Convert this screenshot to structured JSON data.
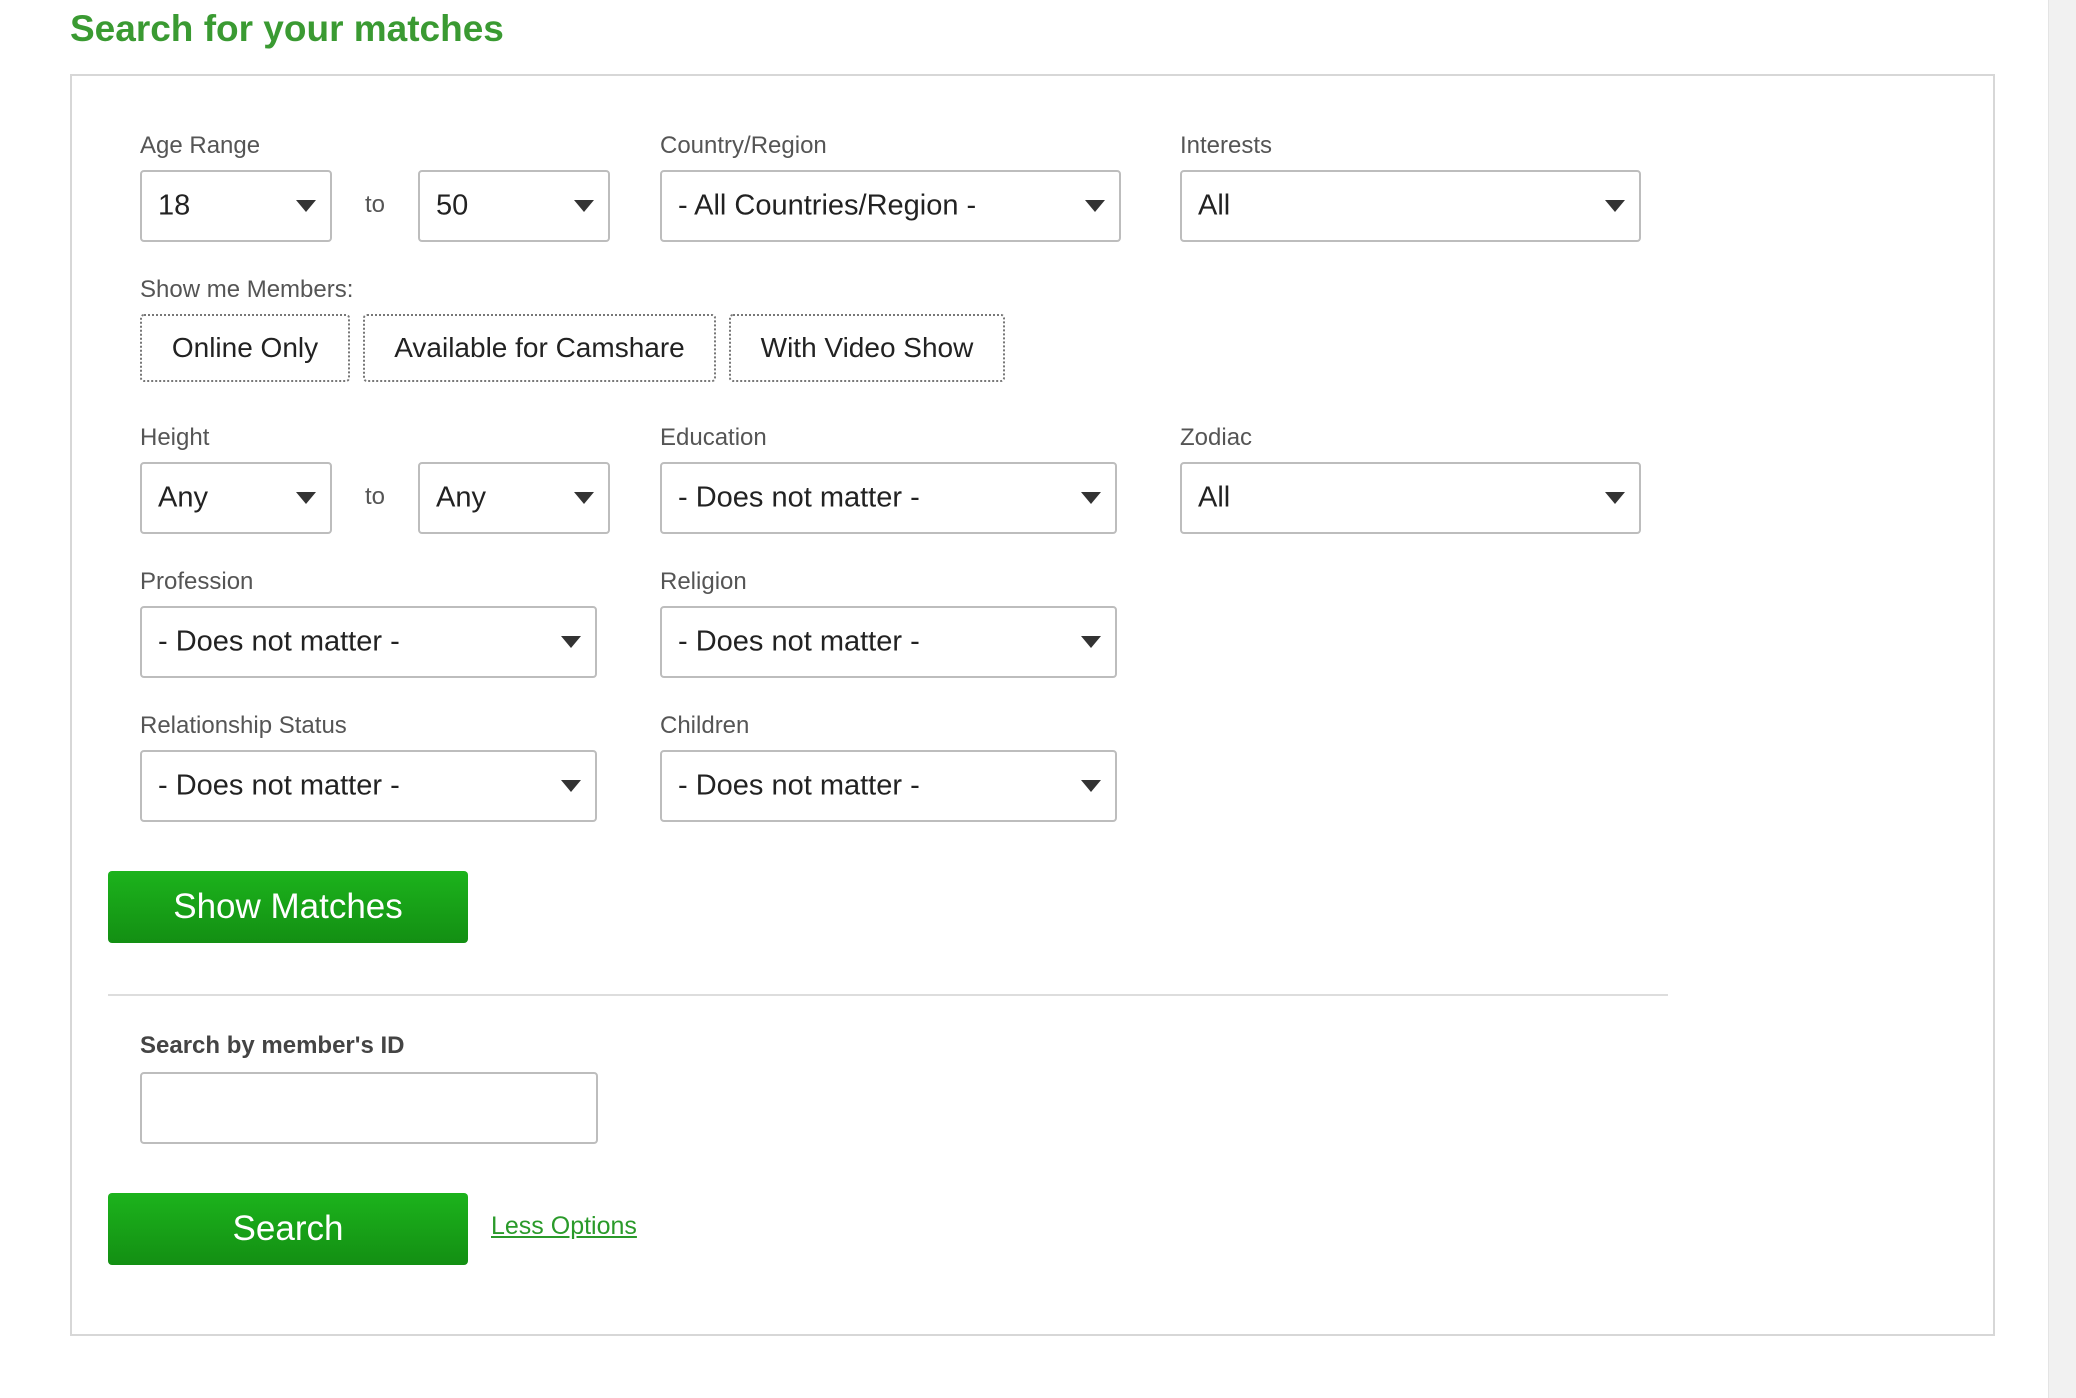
{
  "title": "Search for your matches",
  "age_range": {
    "label": "Age Range",
    "from": "18",
    "to_label": "to",
    "to": "50"
  },
  "country": {
    "label": "Country/Region",
    "value": "- All Countries/Region -"
  },
  "interests": {
    "label": "Interests",
    "value": "All"
  },
  "show_members": {
    "label": "Show me Members:",
    "online_only": "Online Only",
    "camshare": "Available for Camshare",
    "video_show": "With Video Show"
  },
  "height": {
    "label": "Height",
    "from": "Any",
    "to_label": "to",
    "to": "Any"
  },
  "education": {
    "label": "Education",
    "value": "- Does not matter -"
  },
  "zodiac": {
    "label": "Zodiac",
    "value": "All"
  },
  "profession": {
    "label": "Profession",
    "value": "- Does not matter -"
  },
  "religion": {
    "label": "Religion",
    "value": "- Does not matter -"
  },
  "relationship": {
    "label": "Relationship Status",
    "value": "- Does not matter -"
  },
  "children": {
    "label": "Children",
    "value": "- Does not matter -"
  },
  "show_matches_label": "Show Matches",
  "member_id": {
    "label": "Search by member's ID",
    "value": "",
    "placeholder": ""
  },
  "search_label": "Search",
  "less_options_label": "Less Options"
}
